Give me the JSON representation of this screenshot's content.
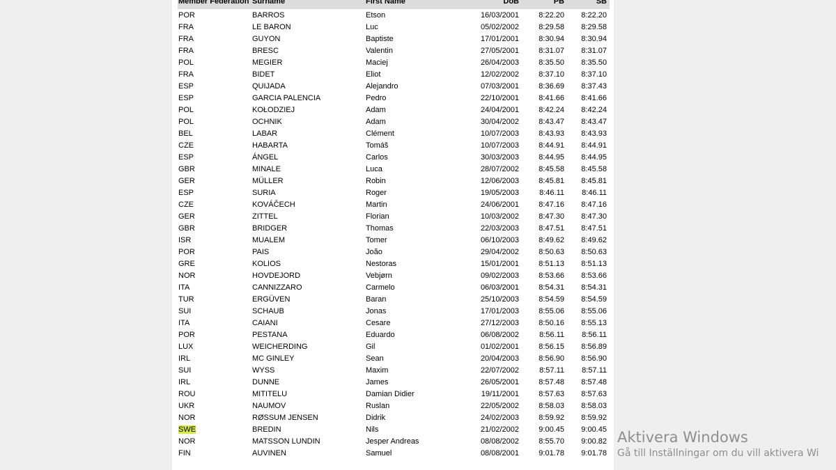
{
  "table": {
    "headers": [
      "Member Federation",
      "Surname",
      "First Name",
      "DoB",
      "PB",
      "SB"
    ],
    "rows": [
      [
        "POR",
        "BARROS",
        "Etson",
        "16/03/2001",
        "8:22.20",
        "8:22.20"
      ],
      [
        "FRA",
        "LE BARON",
        "Luc",
        "05/02/2002",
        "8:29.58",
        "8:29.58"
      ],
      [
        "FRA",
        "GUYON",
        "Baptiste",
        "17/01/2001",
        "8:30.94",
        "8:30.94"
      ],
      [
        "FRA",
        "BRESC",
        "Valentin",
        "27/05/2001",
        "8:31.07",
        "8:31.07"
      ],
      [
        "POL",
        "MEGIER",
        "Maciej",
        "26/04/2003",
        "8:35.50",
        "8:35.50"
      ],
      [
        "FRA",
        "BIDET",
        "Eliot",
        "12/02/2002",
        "8:37.10",
        "8:37.10"
      ],
      [
        "ESP",
        "QUIJADA",
        "Alejandro",
        "07/03/2001",
        "8:36.69",
        "8:37.43"
      ],
      [
        "ESP",
        "GARCIA PALENCIA",
        "Pedro",
        "22/10/2001",
        "8:41.66",
        "8:41.66"
      ],
      [
        "POL",
        "KOŁODZIEJ",
        "Adam",
        "24/04/2001",
        "8:42.24",
        "8:42.24"
      ],
      [
        "POL",
        "OCHNIK",
        "Adam",
        "30/04/2002",
        "8:43.47",
        "8:43.47"
      ],
      [
        "BEL",
        "LABAR",
        "Clément",
        "10/07/2003",
        "8:43.93",
        "8:43.93"
      ],
      [
        "CZE",
        "HABARTA",
        "Tomáš",
        "10/07/2003",
        "8:44.91",
        "8:44.91"
      ],
      [
        "ESP",
        "ÁNGEL",
        "Carlos",
        "30/03/2003",
        "8:44.95",
        "8:44.95"
      ],
      [
        "GBR",
        "MINALE",
        "Luca",
        "28/07/2002",
        "8:45.58",
        "8:45.58"
      ],
      [
        "GER",
        "MÜLLER",
        "Robin",
        "12/06/2003",
        "8:45.81",
        "8:45.81"
      ],
      [
        "ESP",
        "SURIA",
        "Roger",
        "19/05/2003",
        "8:46.11",
        "8:46.11"
      ],
      [
        "CZE",
        "KOVÁČECH",
        "Martin",
        "24/06/2001",
        "8:47.16",
        "8:47.16"
      ],
      [
        "GER",
        "ZITTEL",
        "Florian",
        "10/03/2002",
        "8:47.30",
        "8:47.30"
      ],
      [
        "GBR",
        "BRIDGER",
        "Thomas",
        "22/03/2003",
        "8:47.51",
        "8:47.51"
      ],
      [
        "ISR",
        "MUALEM",
        "Tomer",
        "06/10/2003",
        "8:49.62",
        "8:49.62"
      ],
      [
        "POR",
        "PAIS",
        "João",
        "29/04/2002",
        "8:50.63",
        "8:50.63"
      ],
      [
        "GRE",
        "KOLIOS",
        "Nestoras",
        "15/01/2001",
        "8:51.13",
        "8:51.13"
      ],
      [
        "NOR",
        "HOVDEJORD",
        "Vebjørn",
        "09/02/2003",
        "8:53.66",
        "8:53.66"
      ],
      [
        "ITA",
        "CANNIZZARO",
        "Carmelo",
        "06/03/2001",
        "8:54.31",
        "8:54.31"
      ],
      [
        "TUR",
        "ERGÜVEN",
        "Baran",
        "25/10/2003",
        "8:54.59",
        "8:54.59"
      ],
      [
        "SUI",
        "SCHAUB",
        "Jonas",
        "17/01/2003",
        "8:55.06",
        "8:55.06"
      ],
      [
        "ITA",
        "CAIANI",
        "Cesare",
        "27/12/2003",
        "8:50.16",
        "8:55.13"
      ],
      [
        "POR",
        "PESTANA",
        "Eduardo",
        "06/08/2002",
        "8:56.11",
        "8:56.11"
      ],
      [
        "LUX",
        "WEICHERDING",
        "Gil",
        "01/02/2001",
        "8:56.15",
        "8:56.89"
      ],
      [
        "IRL",
        "MC GINLEY",
        "Sean",
        "20/04/2003",
        "8:56.90",
        "8:56.90"
      ],
      [
        "SUI",
        "WYSS",
        "Maxim",
        "22/07/2002",
        "8:57.11",
        "8:57.11"
      ],
      [
        "IRL",
        "DUNNE",
        "James",
        "26/05/2001",
        "8:57.48",
        "8:57.48"
      ],
      [
        "ROU",
        "MITITELU",
        "Damian Didier",
        "19/11/2001",
        "8:57.63",
        "8:57.63"
      ],
      [
        "UKR",
        "NAUMOV",
        "Ruslan",
        "22/05/2002",
        "8:58.03",
        "8:58.03"
      ],
      [
        "NOR",
        "RØSSUM JENSEN",
        "Didrik",
        "24/02/2003",
        "8:59.92",
        "8:59.92"
      ],
      [
        "SWE",
        "BREDIN",
        "Nils",
        "21/02/2002",
        "9:00.45",
        "9:00.45"
      ],
      [
        "NOR",
        "MATSSON LUNDIN",
        "Jesper Andreas",
        "08/08/2002",
        "8:55.70",
        "9:00.82"
      ],
      [
        "FIN",
        "AUVINEN",
        "Samuel",
        "08/08/2001",
        "9:01.78",
        "9:01.78"
      ]
    ],
    "highlighted_cell": {
      "row": 35,
      "col": 0,
      "color": "#d7ec3a"
    }
  },
  "watermark": {
    "title": "Aktivera Windows",
    "subtitle": "Gå till Inställningar om du vill aktivera Wi"
  }
}
